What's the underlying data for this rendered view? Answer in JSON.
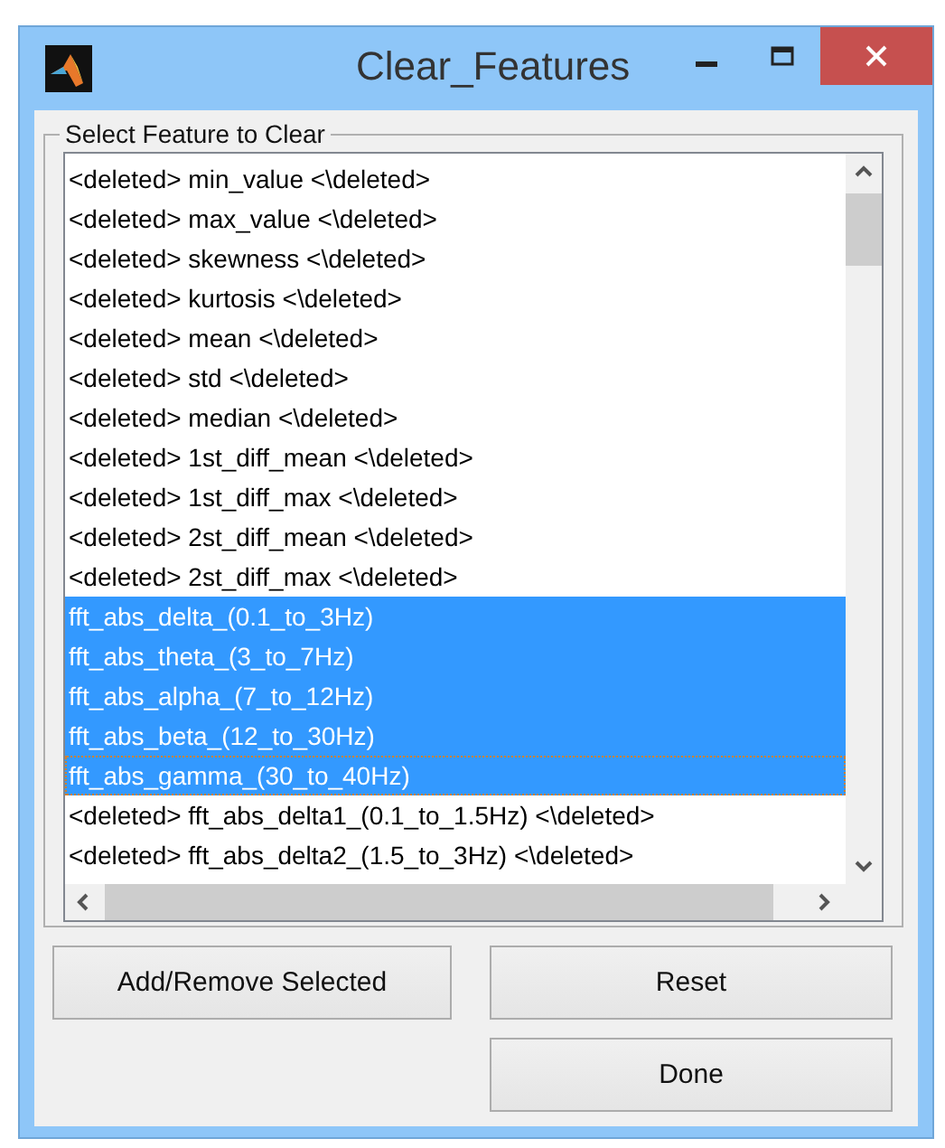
{
  "window": {
    "title": "Clear_Features"
  },
  "group": {
    "label": "Select Feature to Clear"
  },
  "list": {
    "items": [
      {
        "text": "<deleted> min_value <\\deleted>",
        "selected": false,
        "focused": false
      },
      {
        "text": "<deleted> max_value <\\deleted>",
        "selected": false,
        "focused": false
      },
      {
        "text": "<deleted> skewness <\\deleted>",
        "selected": false,
        "focused": false
      },
      {
        "text": "<deleted> kurtosis <\\deleted>",
        "selected": false,
        "focused": false
      },
      {
        "text": "<deleted> mean <\\deleted>",
        "selected": false,
        "focused": false
      },
      {
        "text": "<deleted> std <\\deleted>",
        "selected": false,
        "focused": false
      },
      {
        "text": "<deleted> median <\\deleted>",
        "selected": false,
        "focused": false
      },
      {
        "text": "<deleted> 1st_diff_mean <\\deleted>",
        "selected": false,
        "focused": false
      },
      {
        "text": "<deleted> 1st_diff_max <\\deleted>",
        "selected": false,
        "focused": false
      },
      {
        "text": "<deleted> 2st_diff_mean <\\deleted>",
        "selected": false,
        "focused": false
      },
      {
        "text": "<deleted> 2st_diff_max <\\deleted>",
        "selected": false,
        "focused": false
      },
      {
        "text": "fft_abs_delta_(0.1_to_3Hz)",
        "selected": true,
        "focused": false
      },
      {
        "text": "fft_abs_theta_(3_to_7Hz)",
        "selected": true,
        "focused": false
      },
      {
        "text": "fft_abs_alpha_(7_to_12Hz)",
        "selected": true,
        "focused": false
      },
      {
        "text": "fft_abs_beta_(12_to_30Hz)",
        "selected": true,
        "focused": false
      },
      {
        "text": "fft_abs_gamma_(30_to_40Hz)",
        "selected": true,
        "focused": true
      },
      {
        "text": "<deleted> fft_abs_delta1_(0.1_to_1.5Hz) <\\deleted>",
        "selected": false,
        "focused": false
      },
      {
        "text": "<deleted> fft_abs_delta2_(1.5_to_3Hz) <\\deleted>",
        "selected": false,
        "focused": false
      }
    ]
  },
  "buttons": [
    {
      "label": "Add/Remove Selected"
    },
    {
      "label": "Reset"
    },
    {
      "label": "Done"
    }
  ]
}
